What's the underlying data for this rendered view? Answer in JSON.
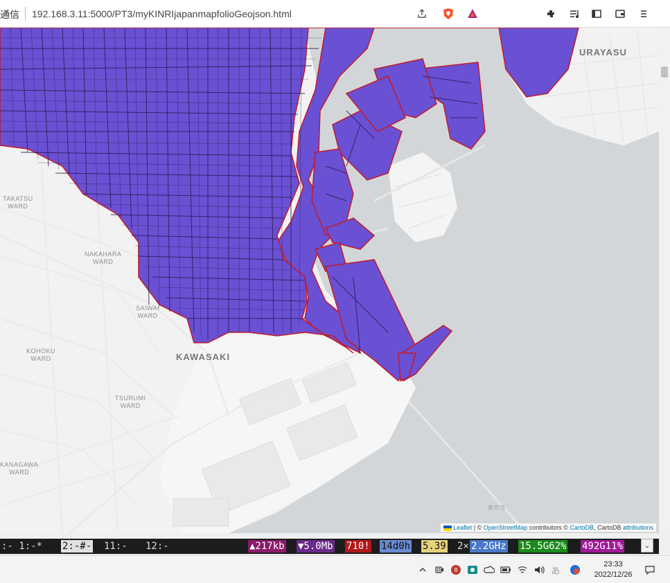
{
  "browser": {
    "security_label": "通信",
    "url": "192.168.3.11:5000/PT3/myKINRIjapanmapfolioGeojson.html"
  },
  "map": {
    "labels": {
      "urayasu": "URAYASU",
      "takatsu": "TAKATSU\nWARD",
      "nakahara": "NAKAHARA\nWARD",
      "saiwai": "SAIWAI\nWARD",
      "kohoku": "KOHOKU\nWARD",
      "kawasaki": "KAWASAKI",
      "tsurumi": "TSURUMI\nWARD",
      "kanagawa": "KANAGAWA\nWARD",
      "tokyo_bay": "東京湾"
    },
    "colors": {
      "polygon_fill": "#6a50d3",
      "polygon_stroke": "#2a1a55",
      "outline": "#c21a2a",
      "land": "#f2f2f2",
      "water": "#d3d6d9"
    },
    "attribution": {
      "leaflet": "Leaflet",
      "sep1": " | © ",
      "osm": "OpenStreetMap",
      "contributors": " contributors © ",
      "carto": "CartoDB",
      "mid": ", CartoDB ",
      "attributions": "attributions"
    }
  },
  "statusbar": {
    "left": ":-  1:-*",
    "win2": "2:-#-",
    "win11": "11:-",
    "win12": "12:-",
    "up": "▲217kb",
    "down": "▼5.0Mb",
    "s710": "710!",
    "uptime": "14d0h",
    "load": "5.39",
    "cpu_x": "2×",
    "cpu": "2.2GHz",
    "mem": "15.5G62%",
    "disk": "492G11%",
    "scroll_arrow": "⌄"
  },
  "taskbar": {
    "time": "23:33",
    "date": "2022/12/26",
    "ime": "あ"
  }
}
